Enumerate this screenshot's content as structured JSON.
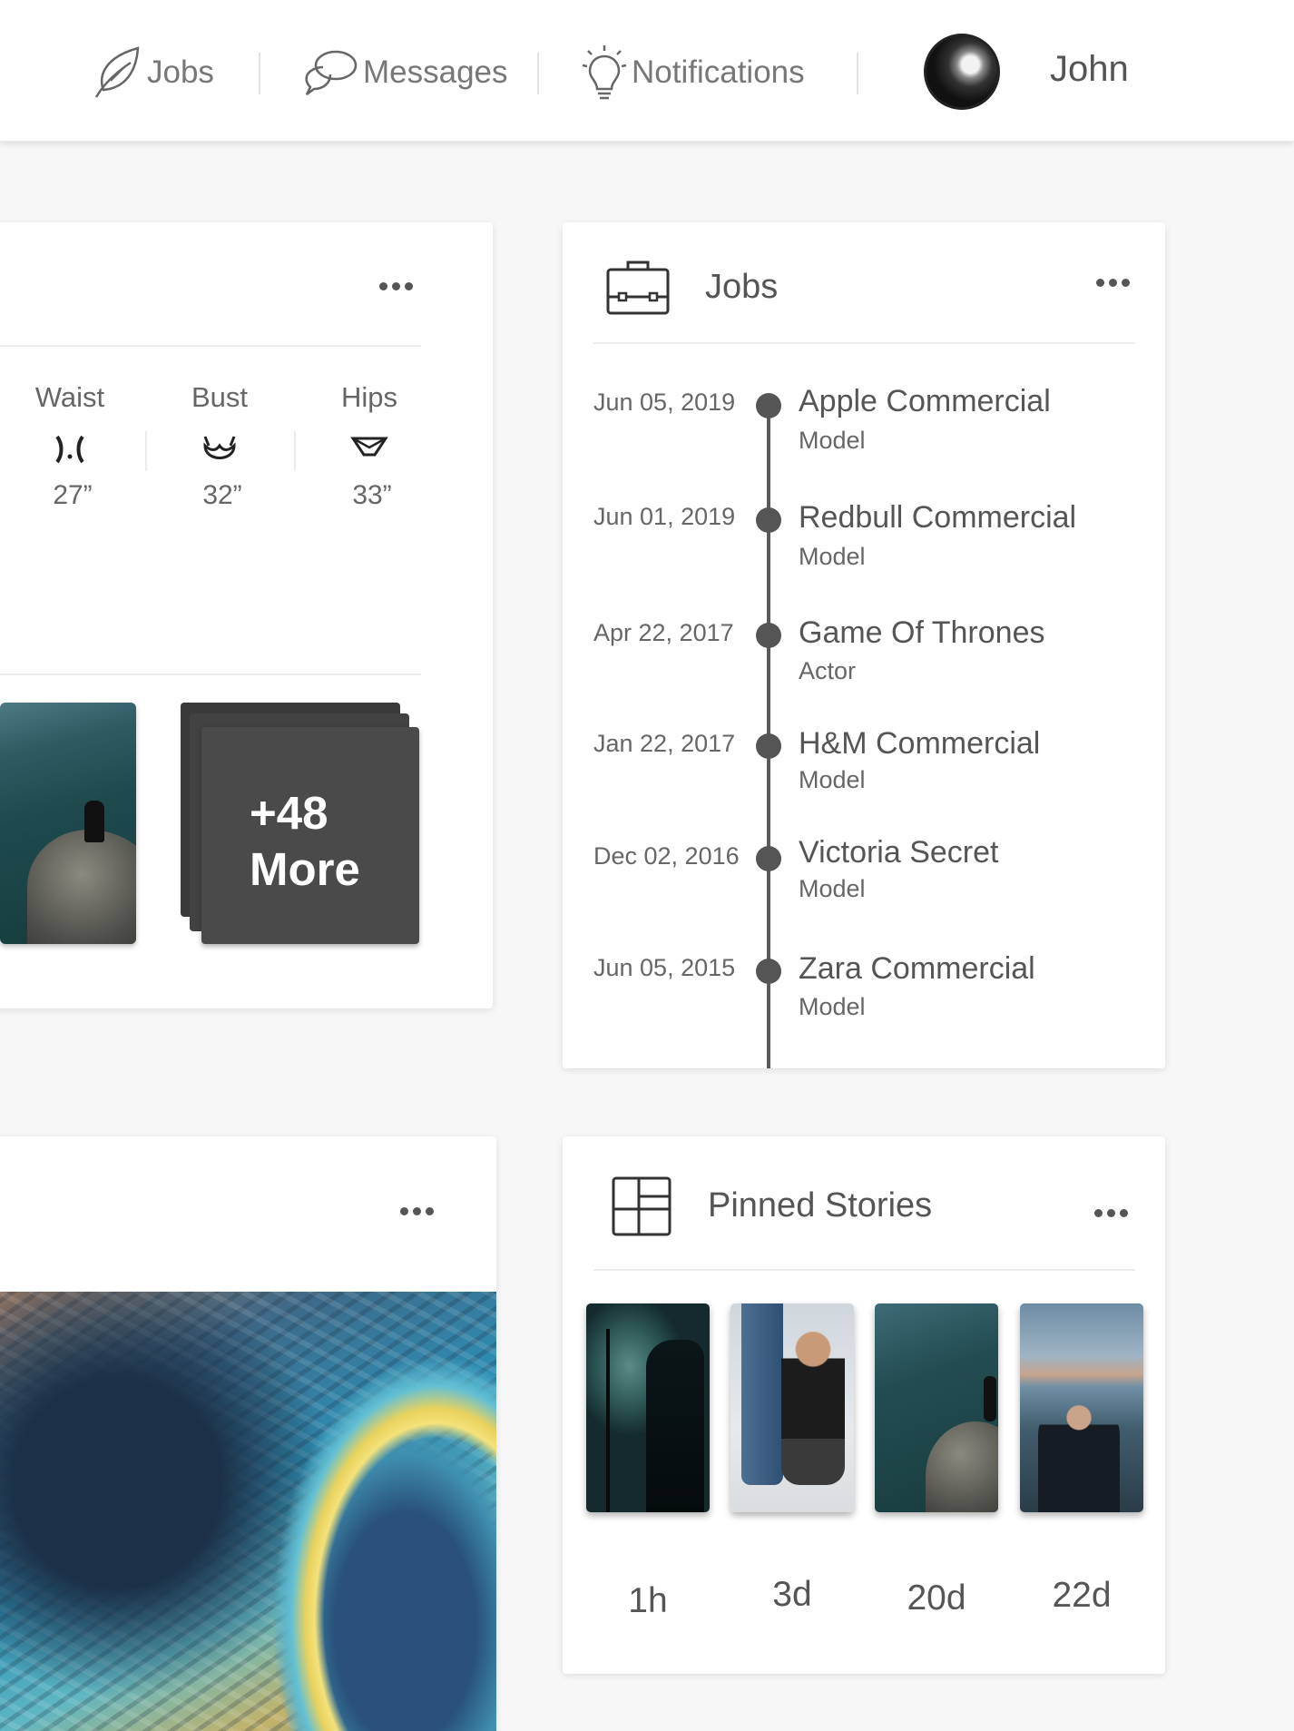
{
  "nav": {
    "jobs": "Jobs",
    "messages": "Messages",
    "notifications": "Notifications",
    "user_name": "John"
  },
  "profile": {
    "measurements": [
      {
        "label": "Waist",
        "icon": "waist-icon",
        "value": "27”"
      },
      {
        "label": "Bust",
        "icon": "bust-icon",
        "value": "32”"
      },
      {
        "label": "Hips",
        "icon": "hips-icon",
        "value": "33”"
      }
    ],
    "more_count": "+48",
    "more_label": "More"
  },
  "jobs_card": {
    "title": "Jobs",
    "items": [
      {
        "date": "Jun 05, 2019",
        "title": "Apple Commercial",
        "role": "Model"
      },
      {
        "date": "Jun 01, 2019",
        "title": "Redbull Commercial",
        "role": "Model"
      },
      {
        "date": "Apr 22, 2017",
        "title": "Game Of Thrones",
        "role": "Actor"
      },
      {
        "date": "Jan 22, 2017",
        "title": "H&M Commercial",
        "role": "Model"
      },
      {
        "date": "Dec 02, 2016",
        "title": "Victoria Secret",
        "role": "Model"
      },
      {
        "date": "Jun 05, 2015",
        "title": "Zara Commercial",
        "role": "Model"
      }
    ]
  },
  "stories_card": {
    "title": "Pinned Stories",
    "stories": [
      {
        "time": "1h"
      },
      {
        "time": "3d"
      },
      {
        "time": "20d"
      },
      {
        "time": "22d"
      }
    ]
  },
  "colors": {
    "background": "#f7f7f7",
    "card": "#ffffff",
    "text": "#555555",
    "more_tile": "#4a4a4a"
  }
}
